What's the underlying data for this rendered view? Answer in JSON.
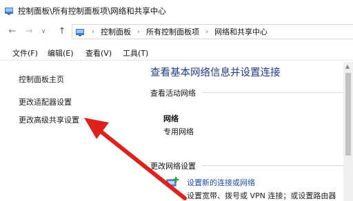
{
  "window": {
    "title": "控制面板\\所有控制面板项\\网络和共享中心"
  },
  "address_bar": {
    "breadcrumbs": [
      "控制面板",
      "所有控制面板项",
      "网络和共享中心"
    ]
  },
  "menu": {
    "items": [
      "文件(F)",
      "编辑(E)",
      "查看(V)",
      "工具(T)"
    ]
  },
  "sidebar": {
    "items": [
      "控制面板主页",
      "更改适配器设置",
      "更改高级共享设置"
    ]
  },
  "main": {
    "heading": "查看基本网络信息并设置连接",
    "active_networks_label": "查看活动网络",
    "network_name": "网络",
    "network_type": "专用网络",
    "change_settings_label": "更改网络设置",
    "setup_link": "设置新的连接或网络",
    "setup_desc": "设置宽带、拨号或 VPN 连接；或设置路由器"
  },
  "colors": {
    "heading": "#1e3a8a",
    "link": "#1e4fa8",
    "arrow": "#e0201b"
  },
  "icons": [
    "control-panel-icon",
    "back-arrow-icon",
    "forward-arrow-icon",
    "recent-dropdown-icon",
    "up-arrow-icon",
    "network-connection-icon"
  ]
}
